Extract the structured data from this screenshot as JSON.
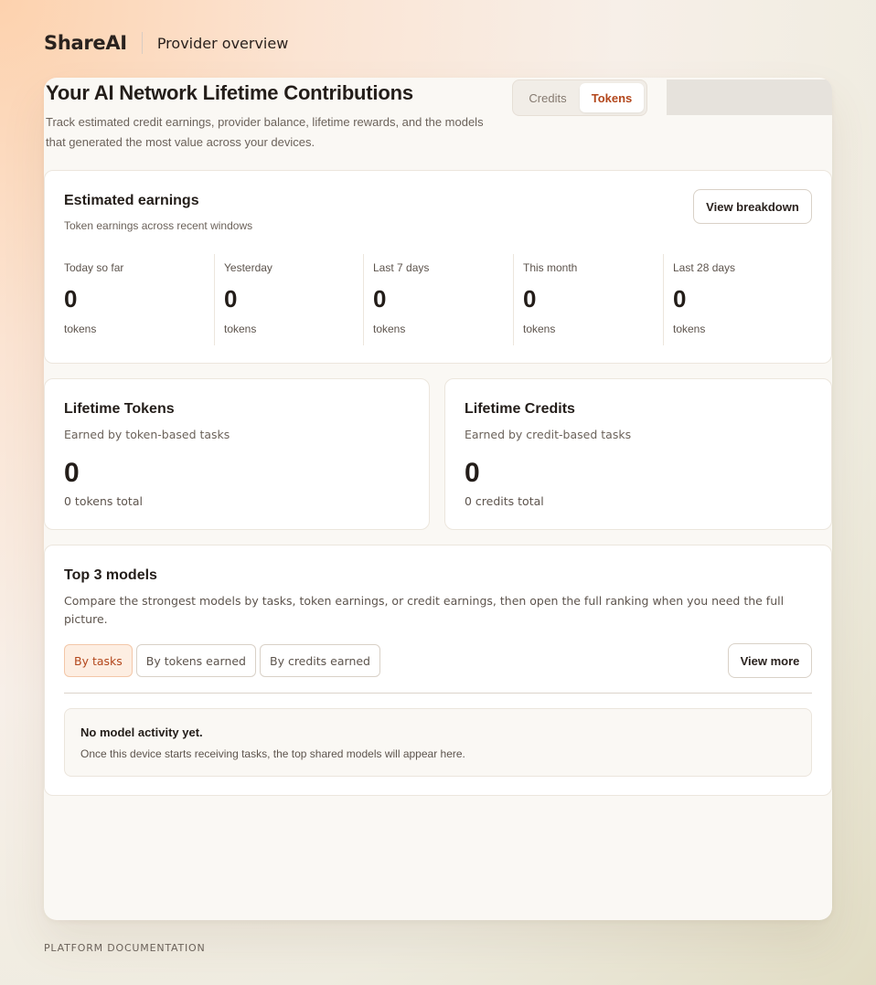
{
  "header": {
    "brand": "ShareAI",
    "page_label": "Provider overview"
  },
  "intro": {
    "title": "Your AI Network Lifetime Contributions",
    "description": "Track estimated credit earnings, provider balance, lifetime rewards, and the models that generated the most value across your devices.",
    "toggle": {
      "options": [
        "Credits",
        "Tokens"
      ],
      "selected": "Tokens"
    }
  },
  "earnings": {
    "title": "Estimated earnings",
    "subtitle": "Token earnings across recent windows",
    "action_label": "View breakdown",
    "stats": [
      {
        "label": "Today so far",
        "value": "0",
        "unit": "tokens"
      },
      {
        "label": "Yesterday",
        "value": "0",
        "unit": "tokens"
      },
      {
        "label": "Last 7 days",
        "value": "0",
        "unit": "tokens"
      },
      {
        "label": "This month",
        "value": "0",
        "unit": "tokens"
      },
      {
        "label": "Last 28 days",
        "value": "0",
        "unit": "tokens"
      }
    ]
  },
  "lifetime_tokens": {
    "title": "Lifetime Tokens",
    "subtitle": "Earned by token-based tasks",
    "value": "0",
    "note": "0 tokens total"
  },
  "lifetime_credits": {
    "title": "Lifetime Credits",
    "subtitle": "Earned by credit-based tasks",
    "value": "0",
    "note": "0 credits total"
  },
  "top_models": {
    "title": "Top 3 models",
    "description": "Compare the strongest models by tasks, token earnings, or credit earnings, then open the full ranking when you need the full picture.",
    "filters": [
      {
        "label": "By tasks",
        "active": true
      },
      {
        "label": "By tokens earned",
        "active": false
      },
      {
        "label": "By credits earned",
        "active": false
      }
    ],
    "action_label": "View more",
    "empty_title": "No model activity yet.",
    "empty_text": "Once this device starts receiving tasks, the top shared models will appear here."
  },
  "footer": {
    "label": "PLATFORM DOCUMENTATION"
  },
  "colors": {
    "accent": "#b3471c",
    "accent_soft_bg": "#fdeee2",
    "panel_bg": "#faf8f4",
    "text_primary": "#231d19",
    "text_muted": "#5d544d"
  }
}
